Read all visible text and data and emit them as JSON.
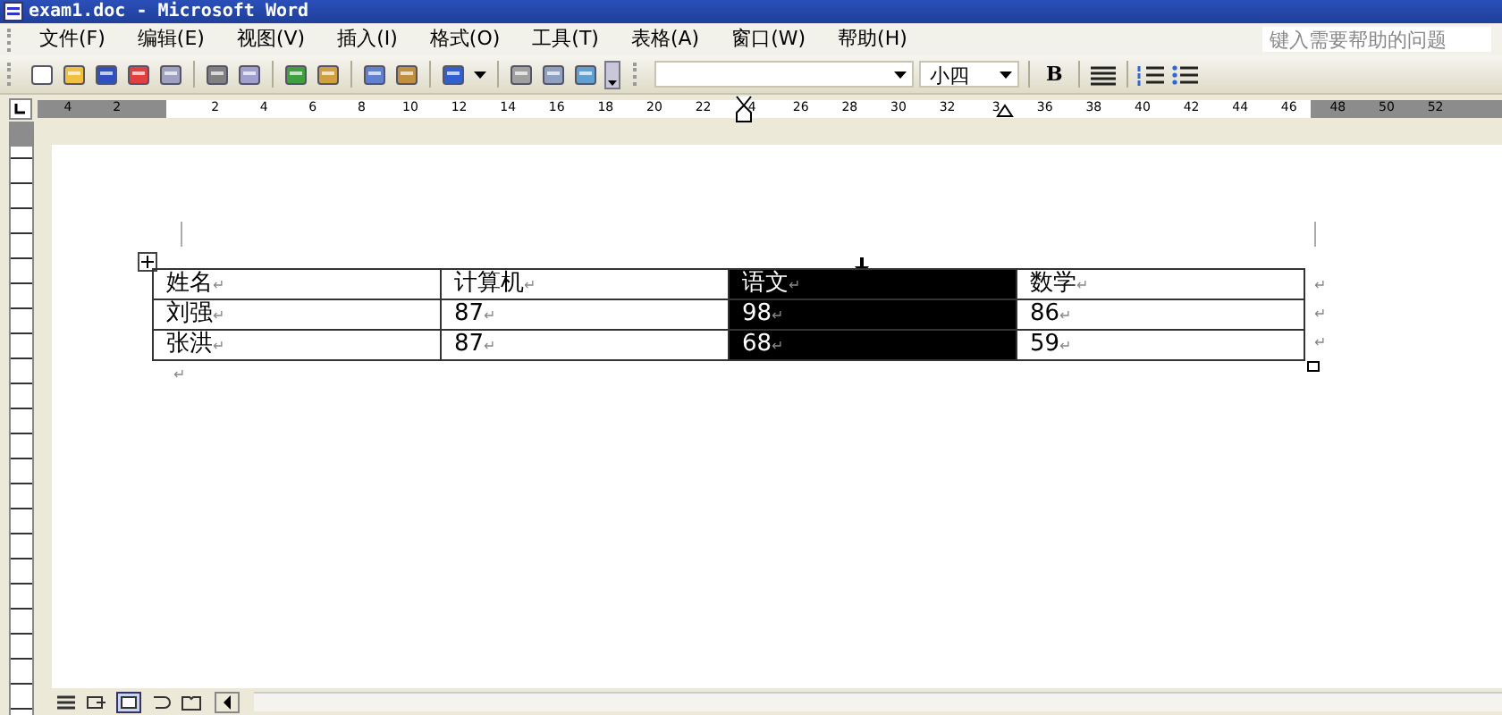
{
  "window": {
    "title": "exam1.doc - Microsoft Word"
  },
  "menu": [
    {
      "label": "文件(F)"
    },
    {
      "label": "编辑(E)"
    },
    {
      "label": "视图(V)"
    },
    {
      "label": "插入(I)"
    },
    {
      "label": "格式(O)"
    },
    {
      "label": "工具(T)"
    },
    {
      "label": "表格(A)"
    },
    {
      "label": "窗口(W)"
    },
    {
      "label": "帮助(H)"
    }
  ],
  "help_box": {
    "placeholder": "键入需要帮助的问题"
  },
  "toolbar": {
    "font_size": "小四",
    "bold": "B"
  },
  "ruler": {
    "left_labels": [
      "4",
      "2"
    ],
    "labels": [
      "2",
      "4",
      "6",
      "8",
      "10",
      "12",
      "14",
      "16",
      "18",
      "20",
      "22",
      "4",
      "26",
      "28",
      "30",
      "32",
      "3",
      "36",
      "38",
      "40",
      "42",
      "44",
      "46",
      "48",
      "50",
      "52"
    ]
  },
  "table": {
    "rows": [
      {
        "cells": [
          {
            "text": "姓名",
            "selected": false
          },
          {
            "text": "计算机",
            "selected": false
          },
          {
            "text": "语文",
            "selected": true
          },
          {
            "text": "数学",
            "selected": false
          }
        ]
      },
      {
        "cells": [
          {
            "text": "刘强",
            "selected": false
          },
          {
            "text": "87",
            "selected": false
          },
          {
            "text": "98",
            "selected": true
          },
          {
            "text": "86",
            "selected": false
          }
        ]
      },
      {
        "cells": [
          {
            "text": "张洪",
            "selected": false
          },
          {
            "text": "87",
            "selected": false
          },
          {
            "text": "68",
            "selected": true
          },
          {
            "text": "59",
            "selected": false
          }
        ]
      }
    ],
    "mark": "↵"
  },
  "paragraph_mark": "↵"
}
